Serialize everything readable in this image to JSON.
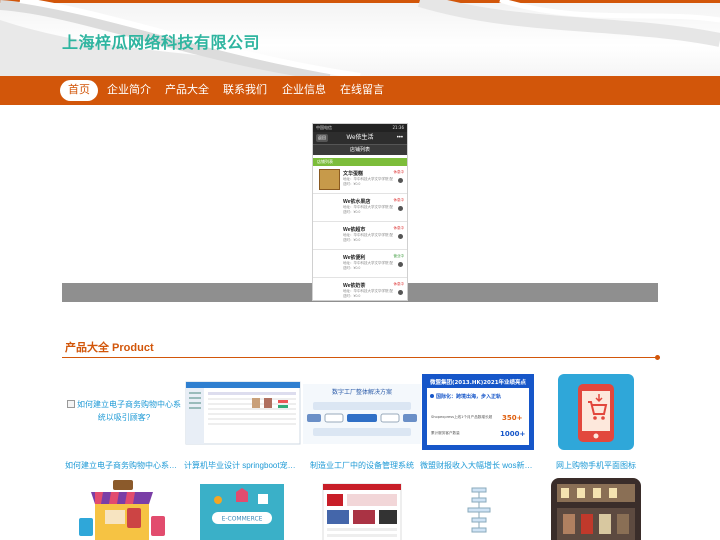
{
  "header": {
    "site_title": "上海梓瓜网络科技有限公司"
  },
  "nav": {
    "items": [
      {
        "label": "首页",
        "active": true
      },
      {
        "label": "企业简介"
      },
      {
        "label": "产品大全"
      },
      {
        "label": "联系我们"
      },
      {
        "label": "企业信息"
      },
      {
        "label": "在线留言"
      }
    ]
  },
  "banner": {
    "phone": {
      "status_left": "中国电信",
      "status_right": "21:36",
      "back": "返回",
      "app_title": "We依生活",
      "more": "•••",
      "subtitle": "店铺列表",
      "list_head": "店铺列表",
      "rows": [
        {
          "name": "文华蛋糕",
          "addr": "地址：华中科技大学文华学院 配送时：¥0.0",
          "tag": "休息中"
        },
        {
          "name": "We依水果店",
          "addr": "地址：华中科技大学文华学院 配送时：¥0.0",
          "tag": "休息中"
        },
        {
          "name": "We依超市",
          "addr": "地址：华中科技大学文华学院 配送时：¥0.0",
          "tag": "休息中"
        },
        {
          "name": "We依便利",
          "addr": "地址：华中科技大学文华学院 配送时：¥0.0",
          "tag": "营业中"
        },
        {
          "name": "We依奶茶",
          "addr": "地址：华中科技大学文华学院 配送时：¥0.0",
          "tag": "休息中"
        }
      ]
    }
  },
  "products": {
    "title": "产品大全 Product",
    "items": [
      {
        "caption": "如何建立电子商务购物中心系统以吸引顾客?",
        "alt": "如何建立电子商务购物中心系统以吸引顾客?"
      },
      {
        "caption": "计算机毕业设计 springboot宠物医院管理系统"
      },
      {
        "caption": "制造业工厂中的设备管理系统",
        "img_text": "数字工厂整体解决方案"
      },
      {
        "caption": "微盟财报收入大幅增长 wos新商业操作系统",
        "img_title": "微盟集团(2013.HK)2021年业绩亮点",
        "img_line": "国际化：跨境出海，步入正轨",
        "img_sub": "Shopexpress上线1个月产品数增长超",
        "img_val1": "350+",
        "img_sub2": "累计服务客户数量",
        "img_val2": "1000+"
      },
      {
        "caption": "网上购物手机平面图标"
      }
    ],
    "row2_banner_text": "E-COMMERCE"
  },
  "colors": {
    "brand": "#d2560a",
    "title": "#2fb5a0",
    "link": "#1e9ad6"
  }
}
